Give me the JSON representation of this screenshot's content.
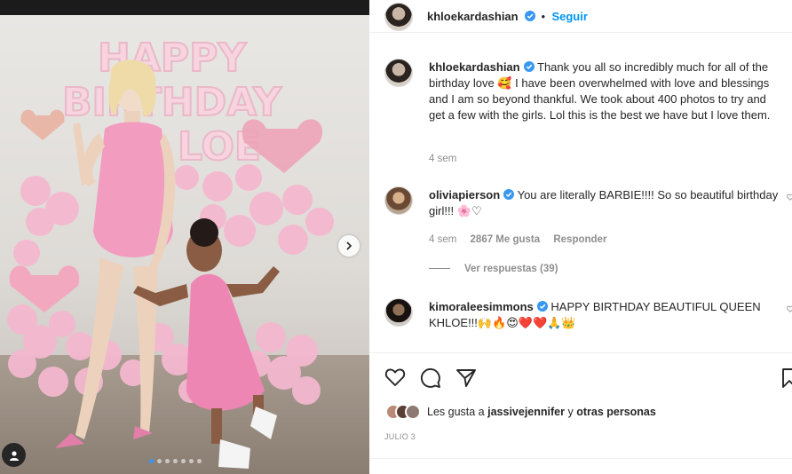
{
  "post": {
    "author": "khloekardashian",
    "follow_label": "Seguir",
    "separator": "•",
    "caption": "Thank you all so incredibly much for all of the birthday love 🥰 I have been overwhelmed with love and blessings and I am so beyond thankful. We took about 400 photos to try and get a few with the girls. Lol this is the best we have but I love them.",
    "caption_age": "4 sem",
    "carousel": {
      "slide_count": 7,
      "current_index": 1
    },
    "balloon_letters": "HAPPY BIRTHDAY KHLOE"
  },
  "comments": [
    {
      "username": "oliviapierson",
      "text": "You are literally BARBIE!!!! So so beautiful birthday girl!!! 🌸♡",
      "age": "4 sem",
      "likes": "2867 Me gusta",
      "reply_label": "Responder",
      "view_replies": "Ver respuestas (39)"
    },
    {
      "username": "kimoraleesimmons",
      "text": "HAPPY BIRTHDAY BEAUTIFUL QUEEN KHLOE!!!🙌🔥😍❤️❤️🙏👑"
    }
  ],
  "likes_line": {
    "prefix": "Les gusta a",
    "user": "jassivejennifer",
    "joiner": "y",
    "others": "otras personas"
  },
  "date": "JULIO 3",
  "icons": [
    "verified-badge-icon",
    "heart-icon",
    "comment-icon",
    "share-icon",
    "bookmark-icon",
    "chevron-right-icon",
    "tag-user-icon"
  ],
  "colors": {
    "accent": "#0095f6",
    "verified": "#3897f0",
    "balloon": "#f4b8cf",
    "dress": "#f29cc0"
  }
}
